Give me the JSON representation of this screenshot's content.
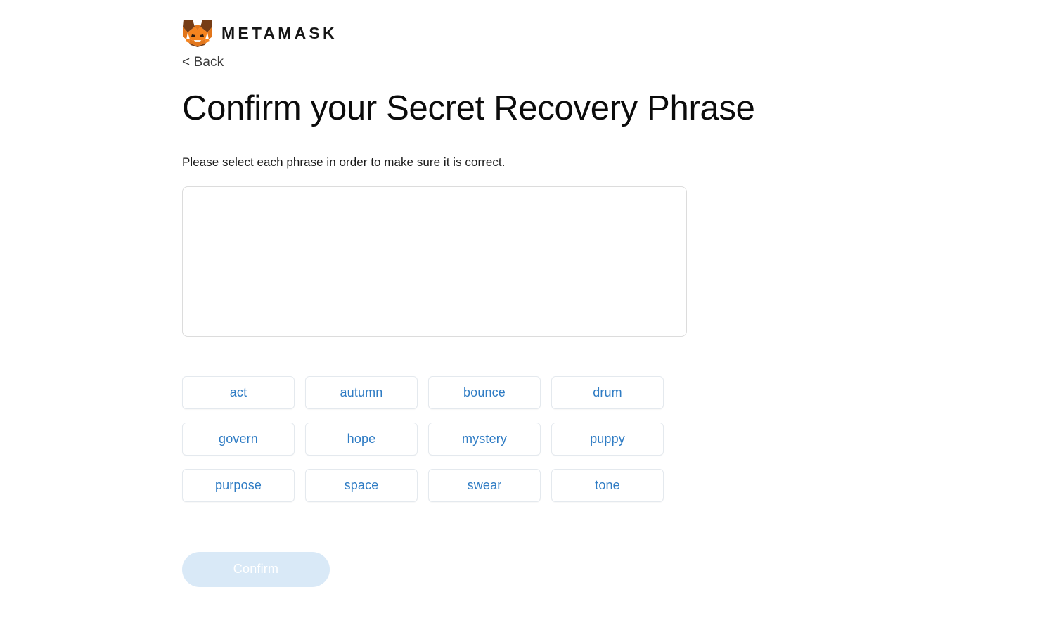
{
  "brand": {
    "logo_icon": "metamask-fox-icon",
    "wordmark": "METAMASK"
  },
  "nav": {
    "back_label": "< Back"
  },
  "header": {
    "title": "Confirm your Secret Recovery Phrase",
    "subtitle": "Please select each phrase in order to make sure it is correct."
  },
  "dropzone": {
    "selected_words": []
  },
  "word_bank": {
    "words": [
      "act",
      "autumn",
      "bounce",
      "drum",
      "govern",
      "hope",
      "mystery",
      "puppy",
      "purpose",
      "space",
      "swear",
      "tone"
    ]
  },
  "actions": {
    "confirm_label": "Confirm",
    "confirm_disabled": true
  },
  "colors": {
    "word_text": "#2f7cc4",
    "word_border": "#e4e9ee",
    "dropzone_border": "#dcdcdc",
    "confirm_bg": "#d9e9f7",
    "confirm_text": "#ffffff",
    "title_text": "#0b0b0b",
    "fox_orange": "#e2761b",
    "fox_dark_brown": "#763d16",
    "fox_light_orange": "#f5841f",
    "fox_cream": "#f6f2ed"
  }
}
